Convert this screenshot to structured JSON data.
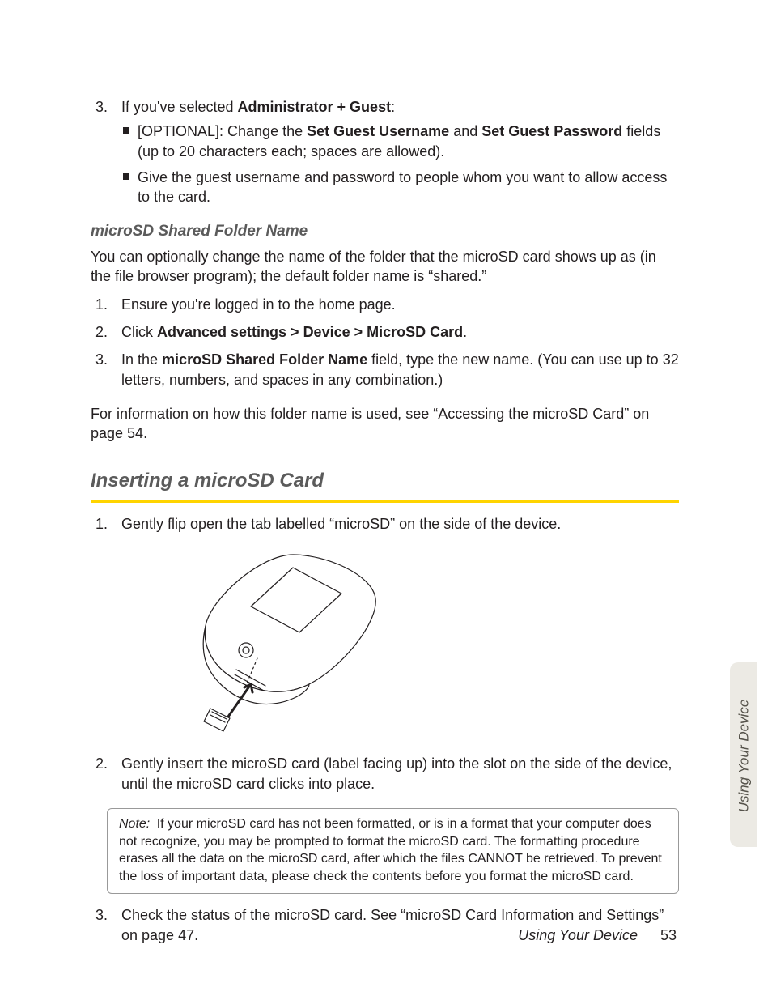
{
  "topList": {
    "item3": {
      "num": "3.",
      "lead": "If you've selected ",
      "bold1": "Administrator + Guest",
      "tail": ":",
      "sub1_pre": "[OPTIONAL]: Change the ",
      "sub1_b1": "Set Guest Username",
      "sub1_mid": " and ",
      "sub1_b2": "Set Guest Password",
      "sub1_post": " fields (up to 20 characters each; spaces are allowed).",
      "sub2": "Give the guest username and password to people whom you want to allow access to the card."
    }
  },
  "subheading1": "microSD Shared Folder Name",
  "para1": "You can optionally change the name of the folder that the microSD card shows up as (in the file browser program); the default folder name is “shared.”",
  "steps1": {
    "s1": {
      "num": "1.",
      "text": "Ensure you're logged in to the home page."
    },
    "s2": {
      "num": "2.",
      "lead": "Click ",
      "b1": "Advanced settings",
      "sep": " > ",
      "b2": "Device",
      "b3": "MicroSD Card",
      "tail": "."
    },
    "s3": {
      "num": "3.",
      "lead": "In the ",
      "b1": "microSD Shared Folder Name",
      "tail": " field, type the new name. (You can use up to 32 letters, numbers, and spaces in any combination.)"
    }
  },
  "para2": "For information on how this folder name is used, see “Accessing the microSD Card” on page 54.",
  "sectionHeading": "Inserting a microSD Card",
  "steps2": {
    "s1": {
      "num": "1.",
      "text": "Gently flip open the tab labelled “microSD” on the side of the device."
    },
    "s2": {
      "num": "2.",
      "text": "Gently insert the microSD card (label facing up) into the slot on the side of the device, until the microSD card clicks into place."
    },
    "s3": {
      "num": "3.",
      "text": "Check the status of the microSD card. See “microSD Card Information and Settings” on page 47."
    }
  },
  "note": {
    "label": "Note:",
    "text": "If your microSD card has not been formatted, or is in a format that your computer does not recognize, you may be prompted to format the microSD card. The formatting procedure erases all the data on the microSD card, after which the files CANNOT be retrieved. To prevent the loss of important data, please check the contents before you format the microSD card."
  },
  "footer": {
    "title": "Using Your Device",
    "page": "53"
  },
  "thumbTab": "Using Your Device"
}
